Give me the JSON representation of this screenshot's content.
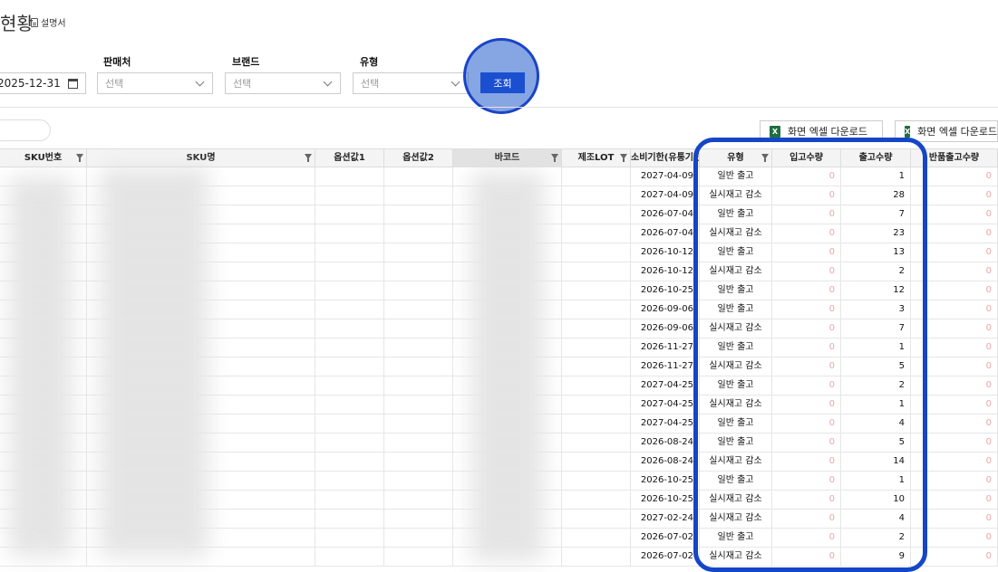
{
  "page": {
    "title": "현황",
    "manual_label": "설명서"
  },
  "filters": {
    "date_value": "2025-12-31",
    "seller": {
      "label": "판매처",
      "placeholder": "선택"
    },
    "brand": {
      "label": "브랜드",
      "placeholder": "선택"
    },
    "type": {
      "label": "유형",
      "placeholder": "선택"
    },
    "search_label": "조회"
  },
  "toolbar": {
    "excel_button": "화면 엑셀 다운로드",
    "excel_button_2": "화면 엑셀 다운로드"
  },
  "table": {
    "columns": [
      "SKU번호",
      "SKU명",
      "옵션값1",
      "옵션값2",
      "바코드",
      "제조LOT",
      "소비기한(유통기한)",
      "유형",
      "입고수량",
      "출고수량",
      "반품출고수량"
    ],
    "rows": [
      [
        "2027-04-09",
        "일반 출고",
        "0",
        "1",
        "0"
      ],
      [
        "2027-04-09",
        "실시재고 감소",
        "0",
        "28",
        "0"
      ],
      [
        "2026-07-04",
        "일반 출고",
        "0",
        "7",
        "0"
      ],
      [
        "2026-07-04",
        "실시재고 감소",
        "0",
        "23",
        "0"
      ],
      [
        "2026-10-12",
        "일반 출고",
        "0",
        "13",
        "0"
      ],
      [
        "2026-10-12",
        "실시재고 감소",
        "0",
        "2",
        "0"
      ],
      [
        "2026-10-25",
        "일반 출고",
        "0",
        "12",
        "0"
      ],
      [
        "2026-09-06",
        "일반 출고",
        "0",
        "3",
        "0"
      ],
      [
        "2026-09-06",
        "실시재고 감소",
        "0",
        "7",
        "0"
      ],
      [
        "2026-11-27",
        "일반 출고",
        "0",
        "1",
        "0"
      ],
      [
        "2026-11-27",
        "실시재고 감소",
        "0",
        "5",
        "0"
      ],
      [
        "2027-04-25",
        "일반 출고",
        "0",
        "2",
        "0"
      ],
      [
        "2027-04-25",
        "실시재고 감소",
        "0",
        "1",
        "0"
      ],
      [
        "2027-04-25",
        "일반 출고",
        "0",
        "4",
        "0"
      ],
      [
        "2026-08-24",
        "일반 출고",
        "0",
        "5",
        "0"
      ],
      [
        "2026-08-24",
        "실시재고 감소",
        "0",
        "14",
        "0"
      ],
      [
        "2026-10-25",
        "일반 출고",
        "0",
        "1",
        "0"
      ],
      [
        "2026-10-25",
        "실시재고 감소",
        "0",
        "10",
        "0"
      ],
      [
        "2027-02-24",
        "실시재고 감소",
        "0",
        "4",
        "0"
      ],
      [
        "2026-07-02",
        "일반 출고",
        "0",
        "2",
        "0"
      ],
      [
        "2026-07-02",
        "실시재고 감소",
        "0",
        "9",
        "0"
      ]
    ]
  },
  "colors": {
    "accent": "#1a4fd0",
    "highlight": "#1546c8",
    "zero_text": "#e8a8a8"
  }
}
